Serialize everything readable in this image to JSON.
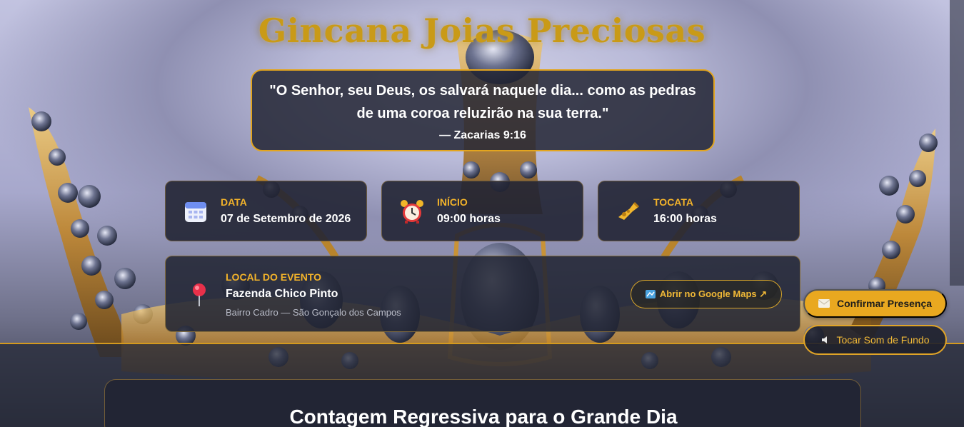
{
  "page": {
    "title": "Gincana Joias Preciosas"
  },
  "verse": {
    "text": "\"O Senhor, seu Deus, os salvará naquele dia... como as pedras de uma coroa reluzirão na sua terra.\"",
    "reference": "— Zacarias 9:16"
  },
  "info_cards": [
    {
      "label": "DATA",
      "value": "07 de Setembro de 2026",
      "icon": "calendar-icon"
    },
    {
      "label": "INÍCIO",
      "value": "09:00 horas",
      "icon": "alarm-clock-icon"
    },
    {
      "label": "TOCATA",
      "value": "16:00 horas",
      "icon": "trumpet-icon"
    }
  ],
  "location": {
    "label": "LOCAL DO EVENTO",
    "name": "Fazenda Chico Pinto",
    "address": "Bairro Cadro — São Gonçalo dos Campos",
    "maps_button": "Abrir no Google Maps ↗",
    "icon": "map-pin-icon"
  },
  "actions": {
    "confirm_label": "Confirmar Presença",
    "sound_label": "Tocar Som de Fundo"
  },
  "countdown": {
    "title": "Contagem Regressiva para o Grande Dia"
  },
  "colors": {
    "accent": "#e9a820",
    "title_gold": "#c99a17",
    "card_bg": "#222534",
    "label_gold": "#f3b32a"
  }
}
